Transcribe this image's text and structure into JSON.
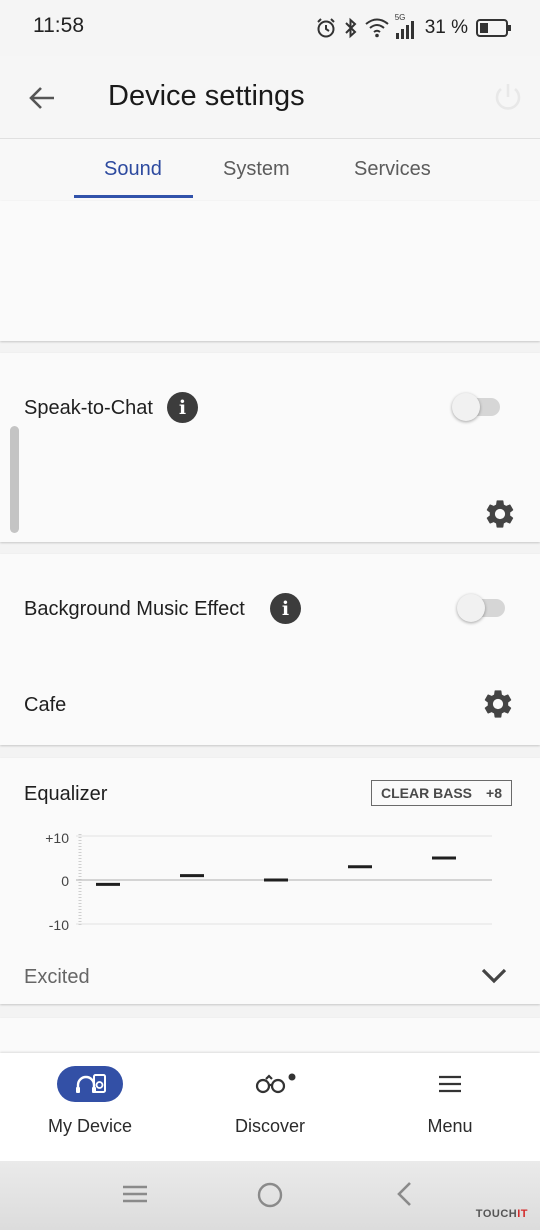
{
  "status_bar": {
    "time": "11:58",
    "battery": "31 %",
    "network": "5G",
    "icons": [
      "alarm-icon",
      "bluetooth-icon",
      "wifi-icon",
      "signal-icon",
      "battery-icon"
    ]
  },
  "header": {
    "title": "Device settings",
    "back_icon": "arrow-left-icon",
    "power_icon": "power-icon"
  },
  "tabs": [
    {
      "label": "Sound",
      "active": true
    },
    {
      "label": "System",
      "active": false
    },
    {
      "label": "Services",
      "active": false
    }
  ],
  "speak_to_chat": {
    "label": "Speak-to-Chat",
    "enabled": false
  },
  "background_music": {
    "label": "Background Music Effect",
    "enabled": false,
    "value": "Cafe"
  },
  "equalizer": {
    "label": "Equalizer",
    "badge_label": "CLEAR BASS",
    "badge_value": "+8",
    "preset": "Excited",
    "axis": {
      "top": "+10",
      "mid": "0",
      "bottom": "-10"
    },
    "ylim": [
      -10,
      10
    ],
    "band_levels": [
      -1,
      1,
      0,
      3,
      5
    ]
  },
  "bottom_nav": {
    "items": [
      {
        "label": "My Device",
        "active": true
      },
      {
        "label": "Discover",
        "active": false
      },
      {
        "label": "Menu",
        "active": false
      }
    ]
  },
  "watermark": {
    "prefix": "TOUCH",
    "suffix": "IT"
  },
  "colors": {
    "accent": "#3152aa",
    "tab_inactive": "#5c5c5c",
    "toggle_off": "#d6d6d6"
  }
}
